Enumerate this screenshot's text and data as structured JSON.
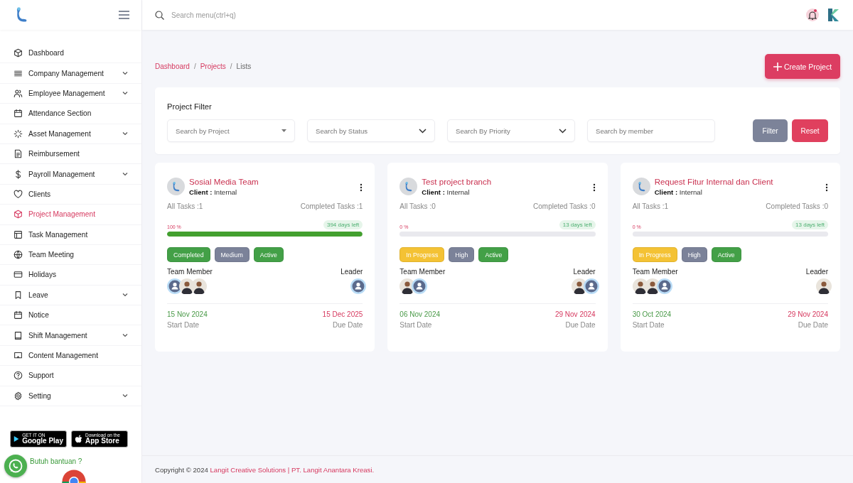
{
  "sidebar": {
    "items": [
      {
        "label": "Dashboard",
        "has_submenu": false,
        "selected": false
      },
      {
        "label": "Company Management",
        "has_submenu": true,
        "selected": false
      },
      {
        "label": "Employee Management",
        "has_submenu": true,
        "selected": false
      },
      {
        "label": "Attendance Section",
        "has_submenu": false,
        "selected": false
      },
      {
        "label": "Asset Management",
        "has_submenu": true,
        "selected": false
      },
      {
        "label": "Reimbursement",
        "has_submenu": false,
        "selected": false
      },
      {
        "label": "Payroll Management",
        "has_submenu": true,
        "selected": false
      },
      {
        "label": "Clients",
        "has_submenu": false,
        "selected": false
      },
      {
        "label": "Project Management",
        "has_submenu": false,
        "selected": true
      },
      {
        "label": "Task Management",
        "has_submenu": false,
        "selected": false
      },
      {
        "label": "Team Meeting",
        "has_submenu": false,
        "selected": false
      },
      {
        "label": "Holidays",
        "has_submenu": false,
        "selected": false
      },
      {
        "label": "Leave",
        "has_submenu": true,
        "selected": false
      },
      {
        "label": "Notice",
        "has_submenu": false,
        "selected": false
      },
      {
        "label": "Shift Management",
        "has_submenu": true,
        "selected": false
      },
      {
        "label": "Content Management",
        "has_submenu": false,
        "selected": false
      },
      {
        "label": "Support",
        "has_submenu": false,
        "selected": false
      },
      {
        "label": "Setting",
        "has_submenu": true,
        "selected": false
      }
    ],
    "store_badges": [
      {
        "kind": "google",
        "small": "GET IT ON",
        "big": "Google Play"
      },
      {
        "kind": "apple",
        "small": "Download on the",
        "big": "App Store"
      }
    ],
    "help_text": "Butuh bantuan ?"
  },
  "topbar": {
    "search": {
      "placeholder": "Search menu(ctrl+q)"
    },
    "notification_dot": true
  },
  "breadcrumb": [
    {
      "kind": "link",
      "label": "Dashboard"
    },
    {
      "kind": "separator",
      "label": "/"
    },
    {
      "kind": "link",
      "label": "Projects"
    },
    {
      "kind": "separator",
      "label": "/"
    },
    {
      "kind": "current",
      "label": "Lists"
    }
  ],
  "create_button": "Create Project",
  "filter": {
    "title": "Project Filter",
    "fields": [
      {
        "kind": "dropdown",
        "placeholder": "Search by Project"
      },
      {
        "kind": "select",
        "placeholder": "Search by Status"
      },
      {
        "kind": "select",
        "placeholder": "Search By Priority"
      },
      {
        "kind": "input",
        "placeholder": "Search by member"
      }
    ],
    "buttons": [
      {
        "label": "Filter",
        "kind": "secondary"
      },
      {
        "label": "Reset",
        "kind": "danger"
      }
    ]
  },
  "projects": [
    {
      "title": "Sosial Media Team",
      "client_label": "Client :",
      "client": "Internal",
      "all_tasks": "All Tasks :1",
      "completed_tasks": "Completed Tasks :1",
      "percent": "100 %",
      "level": 1,
      "days_left": "394 days left",
      "badges": [
        {
          "label": "Completed",
          "color": "#43a047"
        },
        {
          "label": "Medium",
          "color": "#7b8299"
        },
        {
          "label": "Active",
          "color": "#43a047"
        }
      ],
      "team_label": "Team Member",
      "leader_label": "Leader",
      "members": [
        {
          "kind": "placeholder"
        },
        {
          "kind": "photo"
        },
        {
          "kind": "photo"
        }
      ],
      "leaders": [
        {
          "kind": "placeholder"
        }
      ],
      "start_date": "15 Nov 2024",
      "start_label": "Start Date",
      "due_date": "15 Dec 2025",
      "due_label": "Due Date"
    },
    {
      "title": "Test project branch",
      "client_label": "Client :",
      "client": "Internal",
      "all_tasks": "All Tasks :0",
      "completed_tasks": "Completed Tasks :0",
      "percent": "0 %",
      "level": 0,
      "days_left": "13 days left",
      "badges": [
        {
          "label": "In Progress",
          "color": "#f4c234"
        },
        {
          "label": "High",
          "color": "#7b8299"
        },
        {
          "label": "Active",
          "color": "#43a047"
        }
      ],
      "team_label": "Team Member",
      "leader_label": "Leader",
      "members": [
        {
          "kind": "photo"
        },
        {
          "kind": "placeholder"
        }
      ],
      "leaders": [
        {
          "kind": "photo"
        },
        {
          "kind": "placeholder"
        }
      ],
      "start_date": "06 Nov 2024",
      "start_label": "Start Date",
      "due_date": "29 Nov 2024",
      "due_label": "Due Date"
    },
    {
      "title": "Request Fitur Internal dan Client",
      "client_label": "Client :",
      "client": "Internal",
      "all_tasks": "All Tasks :1",
      "completed_tasks": "Completed Tasks :0",
      "percent": "0 %",
      "level": 0,
      "days_left": "13 days left",
      "badges": [
        {
          "label": "In Progress",
          "color": "#f4c234"
        },
        {
          "label": "High",
          "color": "#7b8299"
        },
        {
          "label": "Active",
          "color": "#43a047"
        }
      ],
      "team_label": "Team Member",
      "leader_label": "Leader",
      "members": [
        {
          "kind": "photo"
        },
        {
          "kind": "photo"
        },
        {
          "kind": "placeholder"
        }
      ],
      "leaders": [
        {
          "kind": "photo"
        }
      ],
      "start_date": "30 Oct 2024",
      "start_label": "Start Date",
      "due_date": "29 Nov 2024",
      "due_label": "Due Date"
    }
  ],
  "footer": {
    "text": "Copyright © 2024",
    "link": "Langit Creative Solutions | PT. Langit Anantara Kreasi."
  }
}
